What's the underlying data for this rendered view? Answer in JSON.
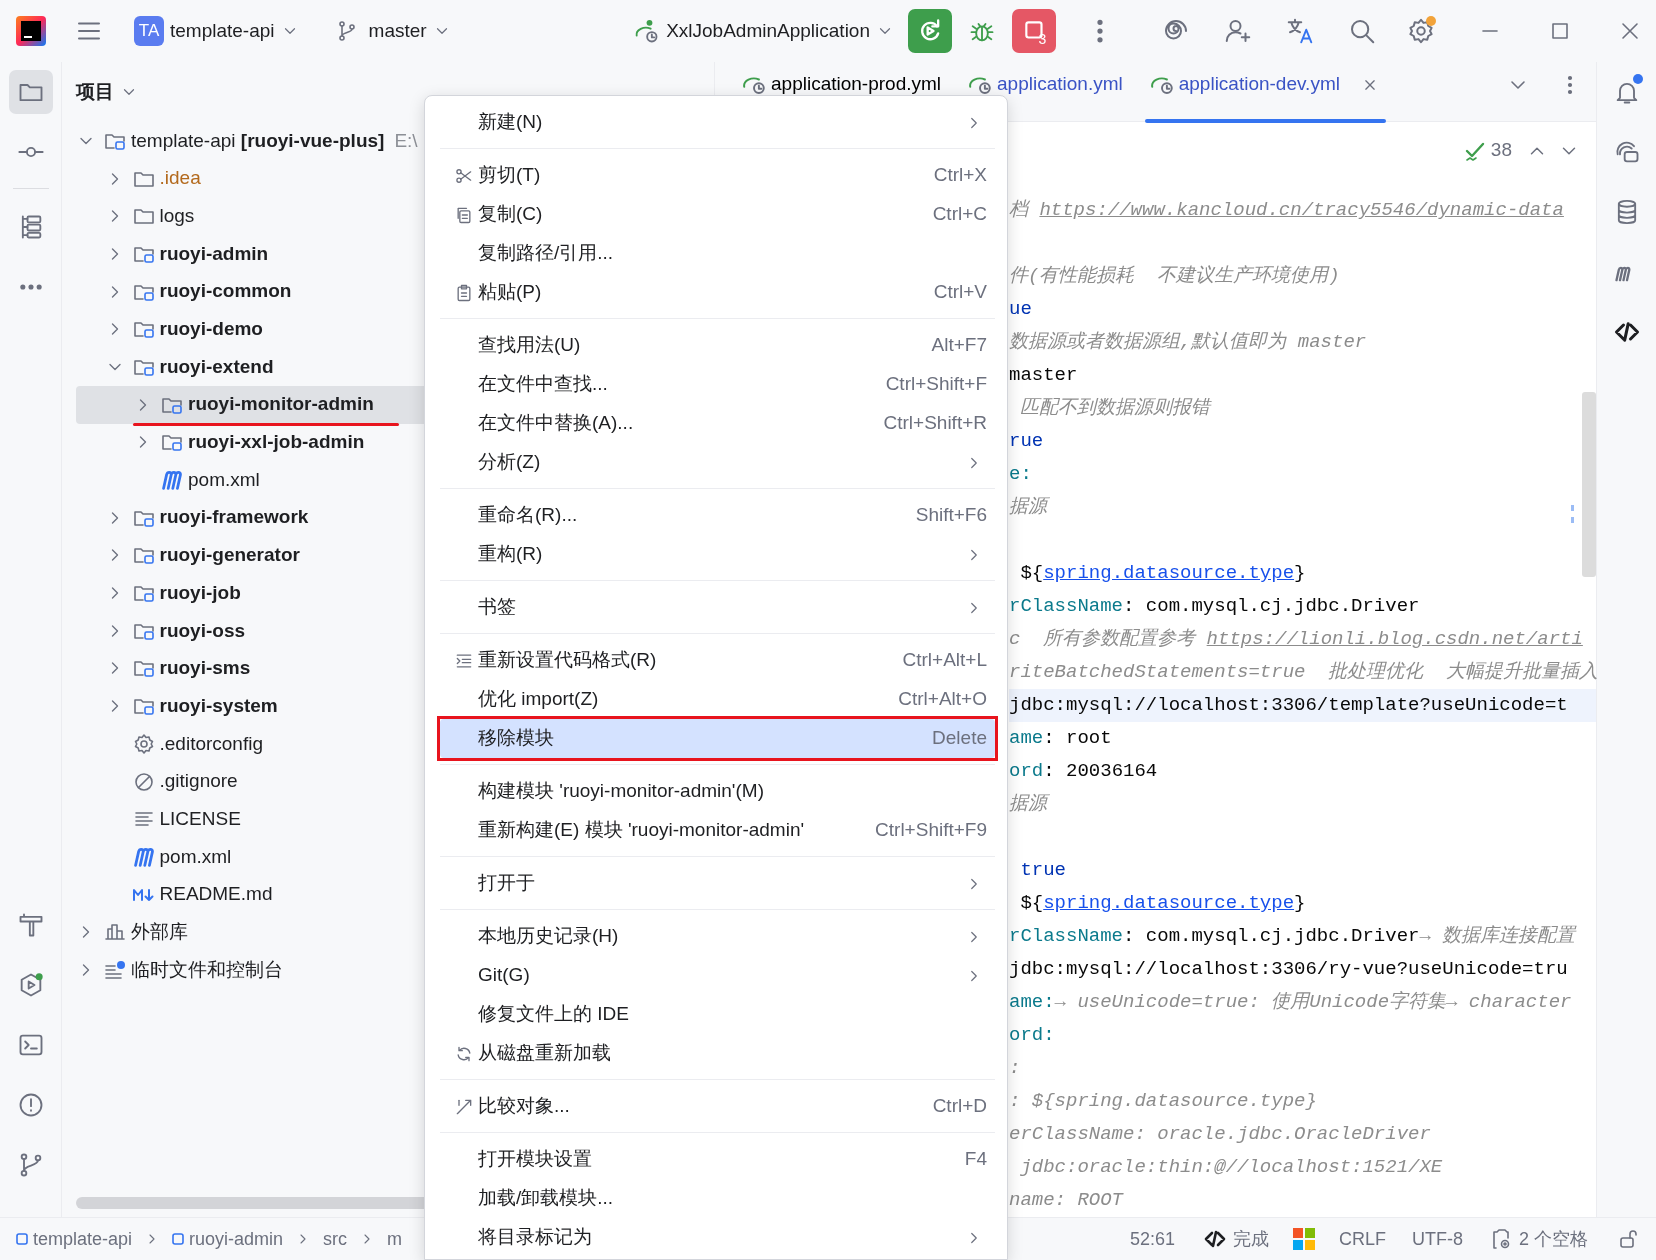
{
  "toolbar": {
    "project_badge": "TA",
    "project": "template-api",
    "branch": "master",
    "run_config": "XxlJobAdminApplication",
    "stop_count": "3",
    "settings_badge": true
  },
  "left_tools": [
    {
      "kind": "project",
      "selected": true
    },
    {
      "kind": "commit",
      "selected": false
    },
    {
      "kind": "structure",
      "selected": false
    },
    {
      "kind": "more",
      "selected": false
    },
    {
      "kind": "build",
      "selected": false
    },
    {
      "kind": "services",
      "selected": false
    },
    {
      "kind": "terminal",
      "selected": false
    },
    {
      "kind": "problems",
      "selected": false
    },
    {
      "kind": "git",
      "selected": false
    }
  ],
  "project_panel": {
    "title": "项目",
    "tree": [
      {
        "label": "template-api **[ruoyi-vue-plus]**",
        "path": "E:\\",
        "kind": "project",
        "expanded": true,
        "selected": false,
        "annotated": false,
        "children": [
          {
            "label": ".idea",
            "kind": "excluded-folder",
            "expanded": false,
            "selected": false,
            "annotated": false
          },
          {
            "label": "logs",
            "kind": "folder",
            "expanded": false,
            "selected": false,
            "annotated": false
          },
          {
            "label": "ruoyi-admin",
            "kind": "module",
            "expanded": false,
            "selected": false,
            "annotated": false
          },
          {
            "label": "ruoyi-common",
            "kind": "module",
            "expanded": false,
            "selected": false,
            "annotated": false
          },
          {
            "label": "ruoyi-demo",
            "kind": "module",
            "expanded": false,
            "selected": false,
            "annotated": false
          },
          {
            "label": "ruoyi-extend",
            "kind": "module",
            "expanded": true,
            "selected": false,
            "annotated": false,
            "children": [
              {
                "label": "ruoyi-monitor-admin",
                "kind": "module",
                "expanded": false,
                "selected": true,
                "annotated": true
              },
              {
                "label": "ruoyi-xxl-job-admin",
                "kind": "module",
                "expanded": false,
                "selected": false,
                "annotated": false
              },
              {
                "label": "pom.xml",
                "kind": "maven",
                "selected": false,
                "annotated": false
              }
            ]
          },
          {
            "label": "ruoyi-framework",
            "kind": "module",
            "expanded": false,
            "selected": false,
            "annotated": false
          },
          {
            "label": "ruoyi-generator",
            "kind": "module",
            "expanded": false,
            "selected": false,
            "annotated": false
          },
          {
            "label": "ruoyi-job",
            "kind": "module",
            "expanded": false,
            "selected": false,
            "annotated": false
          },
          {
            "label": "ruoyi-oss",
            "kind": "module",
            "expanded": false,
            "selected": false,
            "annotated": false
          },
          {
            "label": "ruoyi-sms",
            "kind": "module",
            "expanded": false,
            "selected": false,
            "annotated": false
          },
          {
            "label": "ruoyi-system",
            "kind": "module",
            "expanded": false,
            "selected": false,
            "annotated": false
          },
          {
            "label": ".editorconfig",
            "kind": "config",
            "selected": false,
            "annotated": false
          },
          {
            "label": ".gitignore",
            "kind": "ignore",
            "selected": false,
            "annotated": false
          },
          {
            "label": "LICENSE",
            "kind": "text",
            "selected": false,
            "annotated": false
          },
          {
            "label": "pom.xml",
            "kind": "maven",
            "selected": false,
            "annotated": false
          },
          {
            "label": "README.md",
            "kind": "markdown",
            "selected": false,
            "annotated": false
          }
        ]
      },
      {
        "label": "外部库",
        "kind": "library",
        "expanded": false,
        "selected": false,
        "annotated": false
      },
      {
        "label": "临时文件和控制台",
        "kind": "scratch",
        "expanded": false,
        "selected": false,
        "annotated": false
      }
    ]
  },
  "tabs": [
    {
      "label": "application-prod.yml",
      "selected": false,
      "changed": false
    },
    {
      "label": "application.yml",
      "selected": false,
      "changed": true
    },
    {
      "label": "application-dev.yml",
      "selected": true,
      "changed": true
    }
  ],
  "editor": {
    "problems": "38",
    "lines": [
      {
        "current": false,
        "segments": [
          {
            "kind": "comment",
            "text": "档 "
          },
          {
            "kind": "link",
            "text": "https://www.kancloud.cn/tracy5546/dynamic-data"
          }
        ]
      },
      {
        "current": false
      },
      {
        "current": false,
        "segments": [
          {
            "kind": "comment",
            "text": "件(有性能损耗  不建议生产环境使用)"
          }
        ]
      },
      {
        "current": false,
        "segments": [
          {
            "kind": "keyword",
            "text": "ue"
          }
        ]
      },
      {
        "current": false,
        "segments": [
          {
            "kind": "comment",
            "text": "数据源或者数据源组,默认值即为 master"
          }
        ]
      },
      {
        "current": false,
        "segments": [
          {
            "kind": "plain",
            "text": "master"
          }
        ]
      },
      {
        "current": false,
        "segments": [
          {
            "kind": "comment",
            "text": " 匹配不到数据源则报错"
          }
        ]
      },
      {
        "current": false,
        "segments": [
          {
            "kind": "keyword",
            "text": "rue"
          }
        ]
      },
      {
        "current": false,
        "segments": [
          {
            "kind": "key",
            "text": "e:"
          }
        ]
      },
      {
        "current": false,
        "segments": [
          {
            "kind": "comment",
            "text": "据源"
          }
        ]
      },
      {
        "current": false
      },
      {
        "current": false,
        "segments": [
          {
            "kind": "plain",
            "text": " ${"
          },
          {
            "kind": "ref",
            "text": "spring.datasource.type"
          },
          {
            "kind": "plain",
            "text": "}"
          }
        ]
      },
      {
        "current": false,
        "segments": [
          {
            "kind": "key",
            "text": "rClassName"
          },
          {
            "kind": "plain",
            "text": ": com.mysql.cj.jdbc.Driver"
          }
        ]
      },
      {
        "current": false,
        "segments": [
          {
            "kind": "comment",
            "text": "c  所有参数配置参考 "
          },
          {
            "kind": "link",
            "text": "https://lionli.blog.csdn.net/arti"
          }
        ]
      },
      {
        "current": false,
        "segments": [
          {
            "kind": "comment",
            "text": "riteBatchedStatements=true  批处理优化  大幅提升批量插入"
          }
        ]
      },
      {
        "current": true,
        "segments": [
          {
            "kind": "plain",
            "text": "jdbc:mysql://localhost:3306/template?useUnicode=t"
          }
        ]
      },
      {
        "current": false,
        "segments": [
          {
            "kind": "key",
            "text": "ame"
          },
          {
            "kind": "plain",
            "text": ": root"
          }
        ]
      },
      {
        "current": false,
        "segments": [
          {
            "kind": "key",
            "text": "ord"
          },
          {
            "kind": "plain",
            "text": ": 20036164"
          }
        ]
      },
      {
        "current": false,
        "segments": [
          {
            "kind": "comment",
            "text": "据源"
          }
        ]
      },
      {
        "current": false
      },
      {
        "current": false,
        "segments": [
          {
            "kind": "keyword",
            "text": " true"
          }
        ]
      },
      {
        "current": false,
        "segments": [
          {
            "kind": "plain",
            "text": " ${"
          },
          {
            "kind": "ref",
            "text": "spring.datasource.type"
          },
          {
            "kind": "plain",
            "text": "}"
          }
        ]
      },
      {
        "current": false,
        "segments": [
          {
            "kind": "key",
            "text": "rClassName"
          },
          {
            "kind": "plain",
            "text": ": com.mysql.cj.jdbc.Driver"
          },
          {
            "kind": "comment",
            "text": "→ 数据库连接配置"
          }
        ]
      },
      {
        "current": false,
        "segments": [
          {
            "kind": "plain",
            "text": "jdbc:mysql://localhost:3306/ry-vue?useUnicode=tru"
          }
        ]
      },
      {
        "current": false,
        "segments": [
          {
            "kind": "key",
            "text": "ame:"
          },
          {
            "kind": "comment",
            "text": "→ useUnicode=true: 使用Unicode字符集→ character"
          }
        ]
      },
      {
        "current": false,
        "segments": [
          {
            "kind": "key",
            "text": "ord:"
          }
        ]
      },
      {
        "current": false,
        "segments": [
          {
            "kind": "comment",
            "text": ":"
          }
        ]
      },
      {
        "current": false,
        "segments": [
          {
            "kind": "comment",
            "text": ": ${spring.datasource.type}"
          }
        ]
      },
      {
        "current": false,
        "segments": [
          {
            "kind": "comment",
            "text": "erClassName: oracle.jdbc.OracleDriver"
          }
        ]
      },
      {
        "current": false,
        "segments": [
          {
            "kind": "comment",
            "text": " jdbc:oracle:thin:@//localhost:1521/XE"
          }
        ]
      },
      {
        "current": false,
        "segments": [
          {
            "kind": "comment",
            "text": "name: ROOT"
          }
        ]
      }
    ]
  },
  "notifications": {
    "unread": true
  },
  "context_menu": {
    "groups": [
      {
        "items": [
          {
            "label": "新建(N)",
            "kind": "plain",
            "submenu": true,
            "selected": false,
            "annotated": false
          }
        ]
      },
      {
        "items": [
          {
            "label": "剪切(T)",
            "kind": "cut",
            "shortcut": "Ctrl+X",
            "selected": false,
            "annotated": false
          },
          {
            "label": "复制(C)",
            "kind": "copy",
            "shortcut": "Ctrl+C",
            "selected": false,
            "annotated": false
          },
          {
            "label": "复制路径/引用...",
            "kind": "plain",
            "selected": false,
            "annotated": false
          },
          {
            "label": "粘贴(P)",
            "kind": "paste",
            "shortcut": "Ctrl+V",
            "selected": false,
            "annotated": false
          }
        ]
      },
      {
        "items": [
          {
            "label": "查找用法(U)",
            "kind": "plain",
            "shortcut": "Alt+F7",
            "selected": false,
            "annotated": false
          },
          {
            "label": "在文件中查找...",
            "kind": "plain",
            "shortcut": "Ctrl+Shift+F",
            "selected": false,
            "annotated": false
          },
          {
            "label": "在文件中替换(A)...",
            "kind": "plain",
            "shortcut": "Ctrl+Shift+R",
            "selected": false,
            "annotated": false
          },
          {
            "label": "分析(Z)",
            "kind": "plain",
            "submenu": true,
            "selected": false,
            "annotated": false
          }
        ]
      },
      {
        "items": [
          {
            "label": "重命名(R)...",
            "kind": "plain",
            "shortcut": "Shift+F6",
            "selected": false,
            "annotated": false
          },
          {
            "label": "重构(R)",
            "kind": "plain",
            "submenu": true,
            "selected": false,
            "annotated": false
          }
        ]
      },
      {
        "items": [
          {
            "label": "书签",
            "kind": "plain",
            "submenu": true,
            "selected": false,
            "annotated": false
          }
        ]
      },
      {
        "items": [
          {
            "label": "重新设置代码格式(R)",
            "kind": "format",
            "shortcut": "Ctrl+Alt+L",
            "selected": false,
            "annotated": false
          },
          {
            "label": "优化 import(Z)",
            "kind": "plain",
            "shortcut": "Ctrl+Alt+O",
            "selected": false,
            "annotated": false
          },
          {
            "label": "移除模块",
            "kind": "plain",
            "shortcut": "Delete",
            "selected": true,
            "annotated": true
          }
        ]
      },
      {
        "items": [
          {
            "label": "构建模块 'ruoyi-monitor-admin'(M)",
            "kind": "plain",
            "selected": false,
            "annotated": false
          },
          {
            "label": "重新构建(E) 模块 'ruoyi-monitor-admin'",
            "kind": "plain",
            "shortcut": "Ctrl+Shift+F9",
            "selected": false,
            "annotated": false
          }
        ]
      },
      {
        "items": [
          {
            "label": "打开于",
            "kind": "plain",
            "submenu": true,
            "selected": false,
            "annotated": false
          }
        ]
      },
      {
        "items": [
          {
            "label": "本地历史记录(H)",
            "kind": "plain",
            "submenu": true,
            "selected": false,
            "annotated": false
          },
          {
            "label": "Git(G)",
            "kind": "plain",
            "submenu": true,
            "selected": false,
            "annotated": false
          },
          {
            "label": "修复文件上的 IDE",
            "kind": "plain",
            "selected": false,
            "annotated": false
          },
          {
            "label": "从磁盘重新加载",
            "kind": "reload",
            "selected": false,
            "annotated": false
          }
        ]
      },
      {
        "items": [
          {
            "label": "比较对象...",
            "kind": "compare",
            "shortcut": "Ctrl+D",
            "selected": false,
            "annotated": false
          }
        ]
      },
      {
        "items": [
          {
            "label": "打开模块设置",
            "kind": "plain",
            "shortcut": "F4",
            "selected": false,
            "annotated": false
          },
          {
            "label": "加载/卸载模块...",
            "kind": "plain",
            "selected": false,
            "annotated": false
          },
          {
            "label": "将目录标记为",
            "kind": "plain",
            "submenu": true,
            "selected": false,
            "annotated": false
          }
        ]
      }
    ]
  },
  "status_bar": {
    "breadcrumbs": [
      {
        "label": "template-api",
        "kind": "module"
      },
      {
        "label": "ruoyi-admin",
        "kind": "module"
      },
      {
        "label": "src",
        "kind": "plain"
      },
      {
        "label": "m",
        "kind": "plain"
      }
    ],
    "position": "52:61",
    "ai_status": "完成",
    "line_ending": "CRLF",
    "encoding": "UTF-8",
    "indent": "2 个空格"
  }
}
